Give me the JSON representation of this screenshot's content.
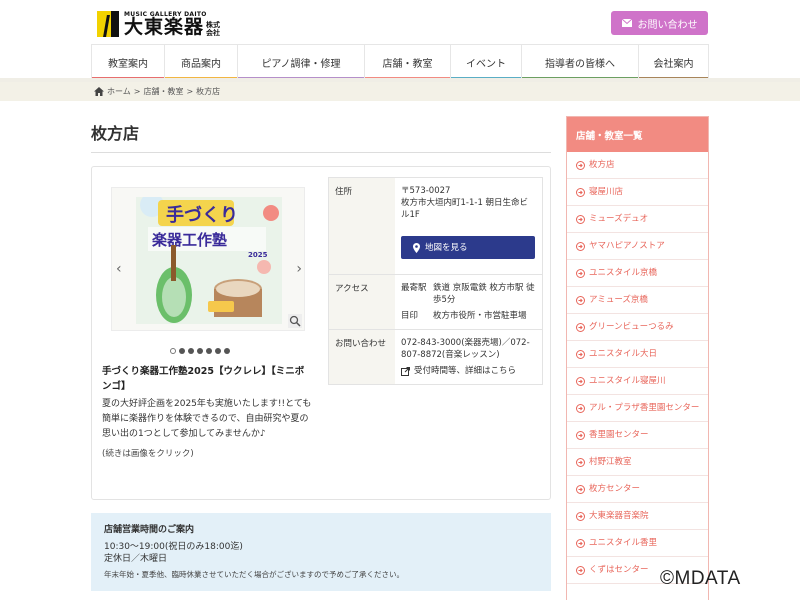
{
  "header": {
    "logo_sub": "MUSIC GALLERY DAITO",
    "logo_name": "大東楽器",
    "logo_corp": "株式会社",
    "contact_label": "お問い合わせ"
  },
  "nav": [
    {
      "label": "教室案内",
      "color": "#e76e6e"
    },
    {
      "label": "商品案内",
      "color": "#f2b642"
    },
    {
      "label": "ピアノ調律・修理",
      "color": "#b58fc9"
    },
    {
      "label": "店舗・教室",
      "color": "#f28b82"
    },
    {
      "label": "イベント",
      "color": "#5aaec5"
    },
    {
      "label": "指導者の皆様へ",
      "color": "#6c9f61"
    },
    {
      "label": "会社案内",
      "color": "#a8855a"
    }
  ],
  "breadcrumb": {
    "home": "ホーム",
    "section": "店舗・教室",
    "current": "枚方店"
  },
  "page": {
    "title": "枚方店"
  },
  "event": {
    "title": "手づくり楽器工作塾2025【ウクレレ】【ミニボンゴ】",
    "desc": "夏の大好評企画を2025年も実施いたします!!とても簡単に楽器作りを体験できるので、自由研究や夏の思い出の1つとして参加してみませんか♪",
    "more": "(続きは画像をクリック)",
    "image_title_line1": "手づくり",
    "image_title_line2": "楽器工作塾",
    "image_year": "2025"
  },
  "slider": {
    "dot_count": 7,
    "active_index": 0
  },
  "info": {
    "address_label": "住所",
    "address_zip": "〒573-0027",
    "address_text": "枚方市大垣内町1-1-1 朝日生命ビル1F",
    "map_button": "地図を見る",
    "access_label": "アクセス",
    "nearest_label": "最寄駅",
    "nearest_value": "鉄道 京阪電鉄 枚方市駅 徒歩5分",
    "landmark_label": "目印",
    "landmark_value": "枚方市役所・市営駐車場",
    "contact_label": "お問い合わせ",
    "phone_text": "072-843-3000(楽器売場)／072-807-8872(音楽レッスン)",
    "hours_link": "受付時間等、詳細はこちら"
  },
  "hours": {
    "title": "店舗営業時間のご案内",
    "time": "10:30〜19:00(祝日のみ18:00迄)",
    "closed": "定休日／木曜日",
    "note": "年末年始・夏季他、臨時休業させていただく場合がございますので予めご了承ください。"
  },
  "sidebar": {
    "title": "店舗・教室一覧",
    "items": [
      "枚方店",
      "寝屋川店",
      "ミューズデュオ",
      "ヤマハピアノストア",
      "ユニスタイル京橋",
      "アミューズ京橋",
      "グリーンビューつるみ",
      "ユニスタイル大日",
      "ユニスタイル寝屋川",
      "アル・プラザ香里園センター",
      "香里園センター",
      "村野江教室",
      "枚方センター",
      "大東楽器音楽院",
      "ユニスタイル香里",
      "くずはセンター"
    ]
  },
  "watermark": "©MDATA",
  "colors": {
    "accent_pink": "#f28b82",
    "contact_purple": "#cf73c9",
    "map_button_navy": "#2c3a8c",
    "hours_bg": "#e3f0f8"
  }
}
